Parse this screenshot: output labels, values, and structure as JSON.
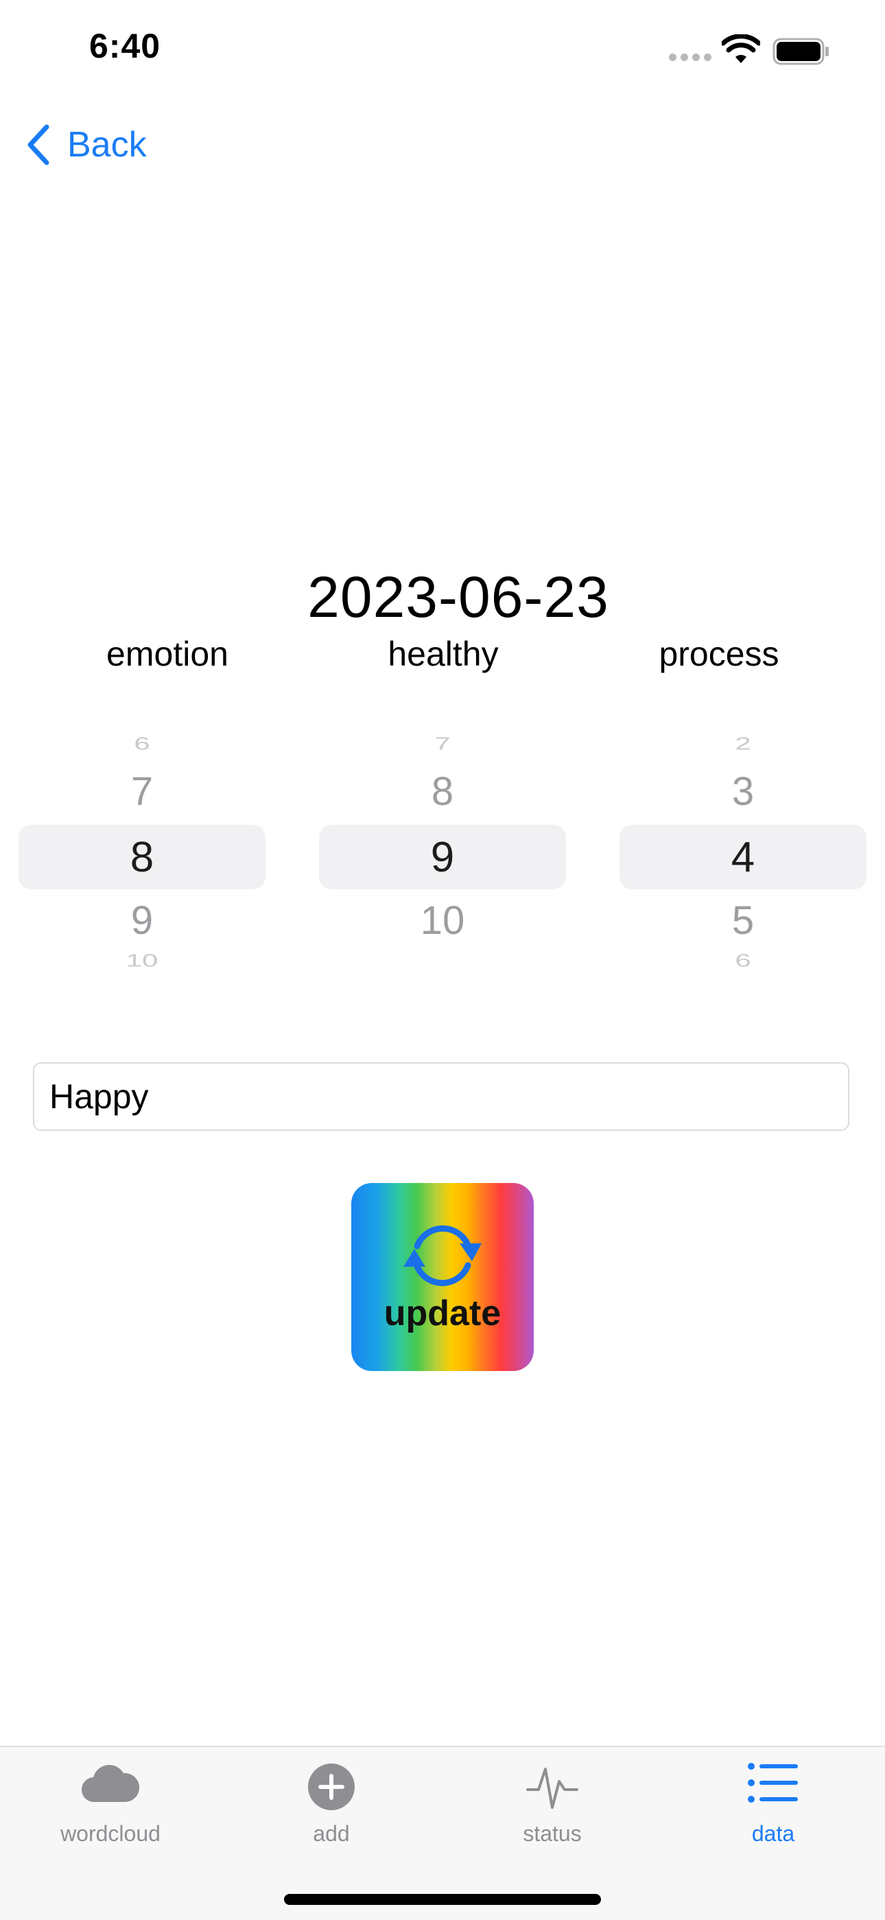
{
  "status_bar": {
    "time": "6:40"
  },
  "nav": {
    "back_label": "Back"
  },
  "date": "2023-06-23",
  "columns": [
    {
      "label": "emotion",
      "values": [
        "6",
        "7",
        "8",
        "9",
        "10"
      ],
      "selected": "8"
    },
    {
      "label": "healthy",
      "values": [
        "7",
        "8",
        "9",
        "10",
        ""
      ],
      "selected": "9"
    },
    {
      "label": "process",
      "values": [
        "2",
        "3",
        "4",
        "5",
        "6"
      ],
      "selected": "4"
    }
  ],
  "note": {
    "value": "Happy"
  },
  "update_button": {
    "label": "update",
    "icon": "sync-icon"
  },
  "tabs": [
    {
      "label": "wordcloud",
      "icon": "cloud-icon",
      "active": false
    },
    {
      "label": "add",
      "icon": "plus-circle-icon",
      "active": false
    },
    {
      "label": "status",
      "icon": "waveform-icon",
      "active": false
    },
    {
      "label": "data",
      "icon": "list-icon",
      "active": true
    }
  ],
  "colors": {
    "accent": "#1a7cf5",
    "inactive": "#8e8e93",
    "tab_bar_bg": "#f7f7f7"
  }
}
